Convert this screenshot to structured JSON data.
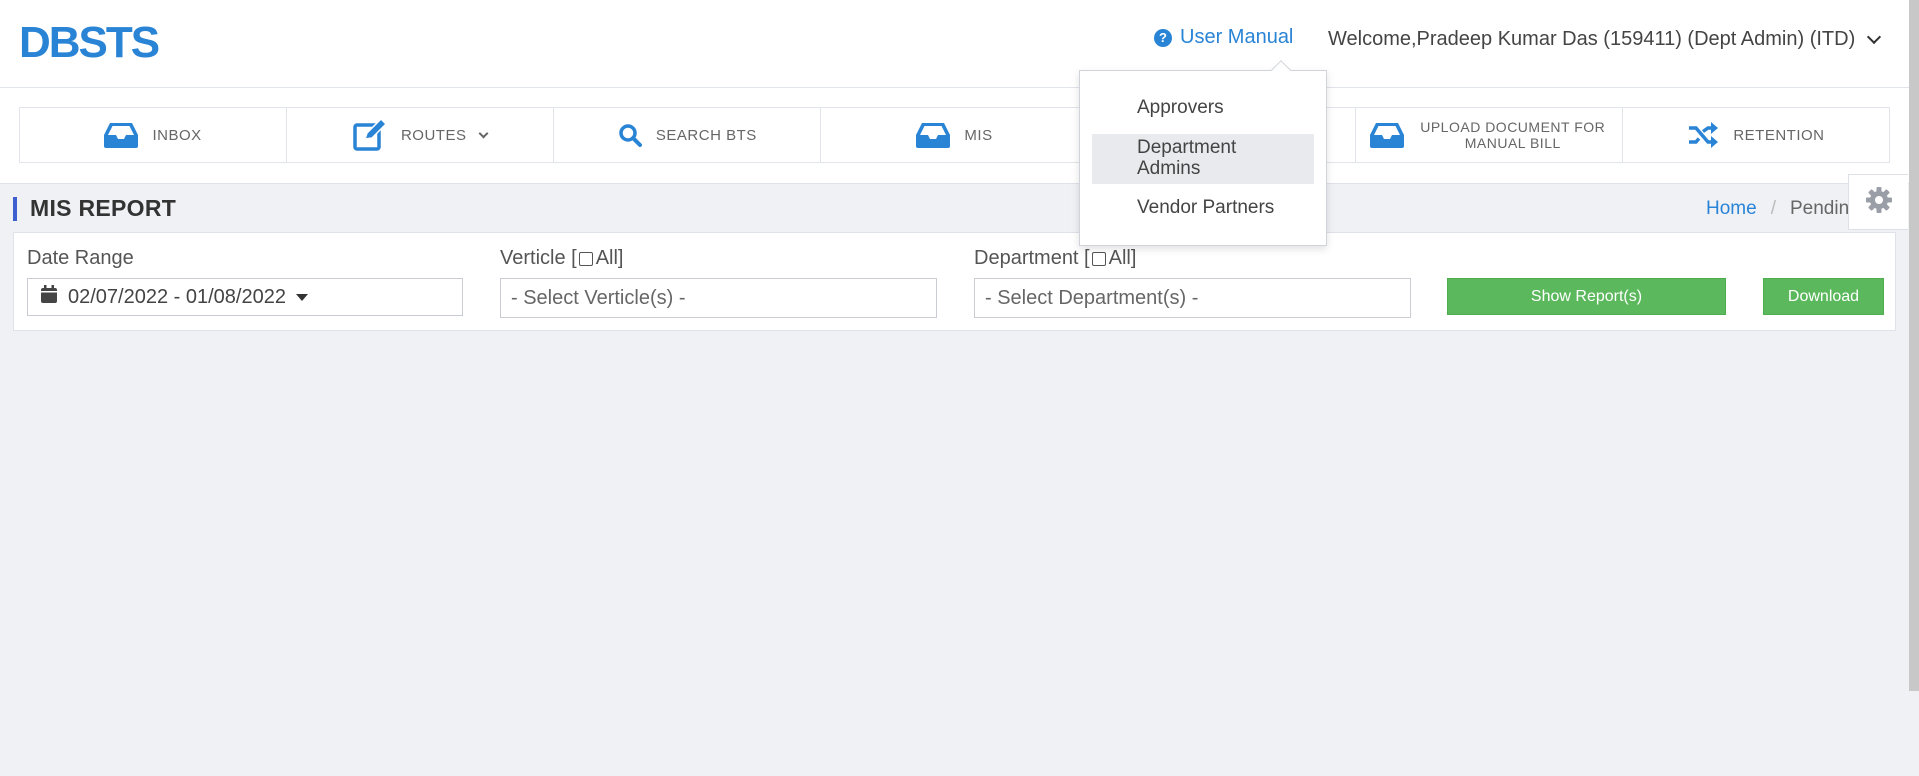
{
  "header": {
    "logo": "DBSTS",
    "user_manual_label": "User Manual",
    "welcome_text": "Welcome,Pradeep Kumar Das (159411) (Dept Admin) (ITD)"
  },
  "nav": {
    "items": [
      {
        "label": "INBOX",
        "icon": "inbox-icon"
      },
      {
        "label": "ROUTES",
        "icon": "edit-icon"
      },
      {
        "label": "SEARCH BTS",
        "icon": "search-icon"
      },
      {
        "label": "MIS",
        "icon": "inbox-icon"
      },
      {
        "label": "",
        "icon": ""
      },
      {
        "label": "UPLOAD DOCUMENT FOR MANUAL BILL",
        "icon": "inbox-icon"
      },
      {
        "label": "RETENTION",
        "icon": "shuffle-icon"
      }
    ]
  },
  "page": {
    "title": "MIS REPORT",
    "breadcrumb": {
      "home": "Home",
      "separator": "/",
      "current": "Pending"
    }
  },
  "filters": {
    "date_range_label": "Date Range",
    "date_range_value": "02/07/2022 - 01/08/2022",
    "verticle_label": "Verticle [",
    "verticle_all": "All]",
    "verticle_placeholder": "- Select Verticle(s) -",
    "department_label": "Department [",
    "department_all": "All]",
    "department_placeholder": "- Select Department(s) -",
    "show_report_label": "Show Report(s)",
    "download_label": "Download"
  },
  "dropdown": {
    "items": [
      "Approvers",
      "Department Admins",
      "Vendor Partners"
    ],
    "active_index": 1
  },
  "colors": {
    "brand": "#2a84d6",
    "accent_bar": "#3f5fd0",
    "button_green": "#5cb85c",
    "background": "#f0f1f5"
  }
}
